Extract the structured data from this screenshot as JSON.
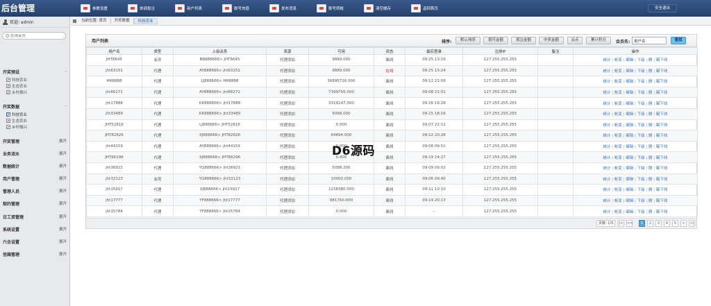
{
  "app": {
    "title": "后台管理",
    "logout": "安全退出"
  },
  "topnav": [
    {
      "label": "参数设置",
      "icon": "settings-icon"
    },
    {
      "label": "体调投注",
      "icon": "bet-icon"
    },
    {
      "label": "用户列表",
      "icon": "users-icon"
    },
    {
      "label": "账号充值",
      "icon": "recharge-icon"
    },
    {
      "label": "发布消息",
      "icon": "message-icon"
    },
    {
      "label": "账号转帐",
      "icon": "transfer-icon"
    },
    {
      "label": "清空缓存",
      "icon": "cache-icon"
    },
    {
      "label": "返回首页",
      "icon": "home-icon"
    }
  ],
  "sidebar": {
    "welcome": "欢迎: admin",
    "search_placeholder": "查询会员",
    "sections": [
      {
        "label": "开奖预设",
        "toggle": "-",
        "subs": [
          "科技农业",
          "生态农业",
          "乡村振兴"
        ]
      },
      {
        "label": "开奖数据",
        "toggle": "-",
        "subs": [
          "科技农业",
          "生态农业",
          "乡村振兴"
        ]
      },
      {
        "label": "开奖管理",
        "toggle": "展开"
      },
      {
        "label": "业务流水",
        "toggle": "展开"
      },
      {
        "label": "数据统计",
        "toggle": "展开"
      },
      {
        "label": "用户管理",
        "toggle": "展开"
      },
      {
        "label": "管理人员",
        "toggle": "展开"
      },
      {
        "label": "契约管理",
        "toggle": "展开"
      },
      {
        "label": "日工资管理",
        "toggle": "展开"
      },
      {
        "label": "系统设置",
        "toggle": "展开"
      },
      {
        "label": "六合设置",
        "toggle": "展开"
      },
      {
        "label": "信箱管理",
        "toggle": "展开"
      }
    ]
  },
  "breadcrumb": [
    "当前位置: 首页",
    "开奖数据",
    "科技农业"
  ],
  "panel": {
    "title": "用户列表",
    "sort_label": "排序:",
    "sort_buttons": [
      "默认排序",
      "按可金额",
      "按注金额",
      "中奖金额",
      "派点",
      "累计积分"
    ],
    "username_label": "会员名:",
    "username_value": "用户名",
    "query_button": "查找"
  },
  "table": {
    "headers": [
      "用户名",
      "类型",
      "上级关系",
      "来源",
      "可用",
      "状态",
      "最后登录",
      "注册IP",
      "备注",
      "操作"
    ],
    "rows": [
      [
        "JHT8645",
        "会员",
        "BB888666> JHT8645",
        "代理添加",
        "9889.000",
        "离线",
        "09-25 13:29",
        "127.255.255.255",
        ""
      ],
      [
        "jht63151",
        "代理",
        "AY888666> jht63151",
        "代理添加",
        "9889.000",
        "在线",
        "09-25 13:24",
        "127.255.255.255",
        ""
      ],
      [
        "HR8888",
        "代理",
        "LJ888666> HR8888",
        "代理添加",
        "36895716.000",
        "离线",
        "09-11 21:09",
        "127.255.255.255",
        ""
      ],
      [
        "jht66271",
        "代理",
        "AY888666> jht66271",
        "代理添加",
        "7399756.000",
        "离线",
        "09-08 21:01",
        "127.255.255.255",
        ""
      ],
      [
        "jht17888",
        "代理",
        "KK888666> jht17888",
        "代理添加",
        "3319147.000",
        "离线",
        "09-16 16:28",
        "127.255.255.255",
        ""
      ],
      [
        "jht33489",
        "代理",
        "KK888666> jht33489",
        "代理添加",
        "5068.000",
        "离线",
        "09-15 18:16",
        "127.255.255.255",
        ""
      ],
      [
        "JHT52816",
        "代理",
        "LJ888666> JHT52816",
        "代理添加",
        "0.000",
        "离线",
        "09-07 22:11",
        "127.255.255.255",
        ""
      ],
      [
        "JHT82826",
        "代理",
        "XJ888666> JHT82826",
        "代理添加",
        "64894.000",
        "离线",
        "09-12 20:28",
        "127.255.255.255",
        ""
      ],
      [
        "jht44159",
        "代理",
        "AY888666> jht44159",
        "代理添加",
        "0.000",
        "离线",
        "09-08 09:51",
        "127.255.255.255",
        ""
      ],
      [
        "JHT66296",
        "代理",
        "XJ888666> JHT66296",
        "代理添加",
        "0.400",
        "离线",
        "09-19 14:27",
        "127.255.255.255",
        ""
      ],
      [
        "jht36921",
        "代理",
        "YG888666> jht36921",
        "代理添加",
        "5088.200",
        "离线",
        "09-09 09:02",
        "127.255.255.255",
        ""
      ],
      [
        "jht32123",
        "会员",
        "YG888666> jht32123",
        "代理添加",
        "10000.000",
        "离线",
        "09-06 09:40",
        "127.255.255.255",
        ""
      ],
      [
        "jht15917",
        "代理",
        "XJ888666> jht15917",
        "代理添加",
        "1158380.000",
        "离线",
        "09-11 10:10",
        "127.255.255.255",
        ""
      ],
      [
        "jht17777",
        "代理",
        "YF888666> jht17777",
        "代理添加",
        "981760.000",
        "离线",
        "09-14 20:13",
        "127.255.255.255",
        ""
      ],
      [
        "jht15784",
        "代理",
        "YF888666> jht15784",
        "代理添加",
        "0.000",
        "离线",
        "--",
        "127.255.255.255",
        ""
      ]
    ],
    "ops": [
      "统计",
      "帐变",
      "编辑",
      "下级",
      "删",
      "踢下线"
    ]
  },
  "pager": {
    "info": "页数: 1/5",
    "buttons": [
      "|<",
      "<<",
      "1",
      "2",
      "3",
      "4",
      "5",
      ">",
      ">|"
    ],
    "current": "1"
  },
  "watermark": "D6源码"
}
